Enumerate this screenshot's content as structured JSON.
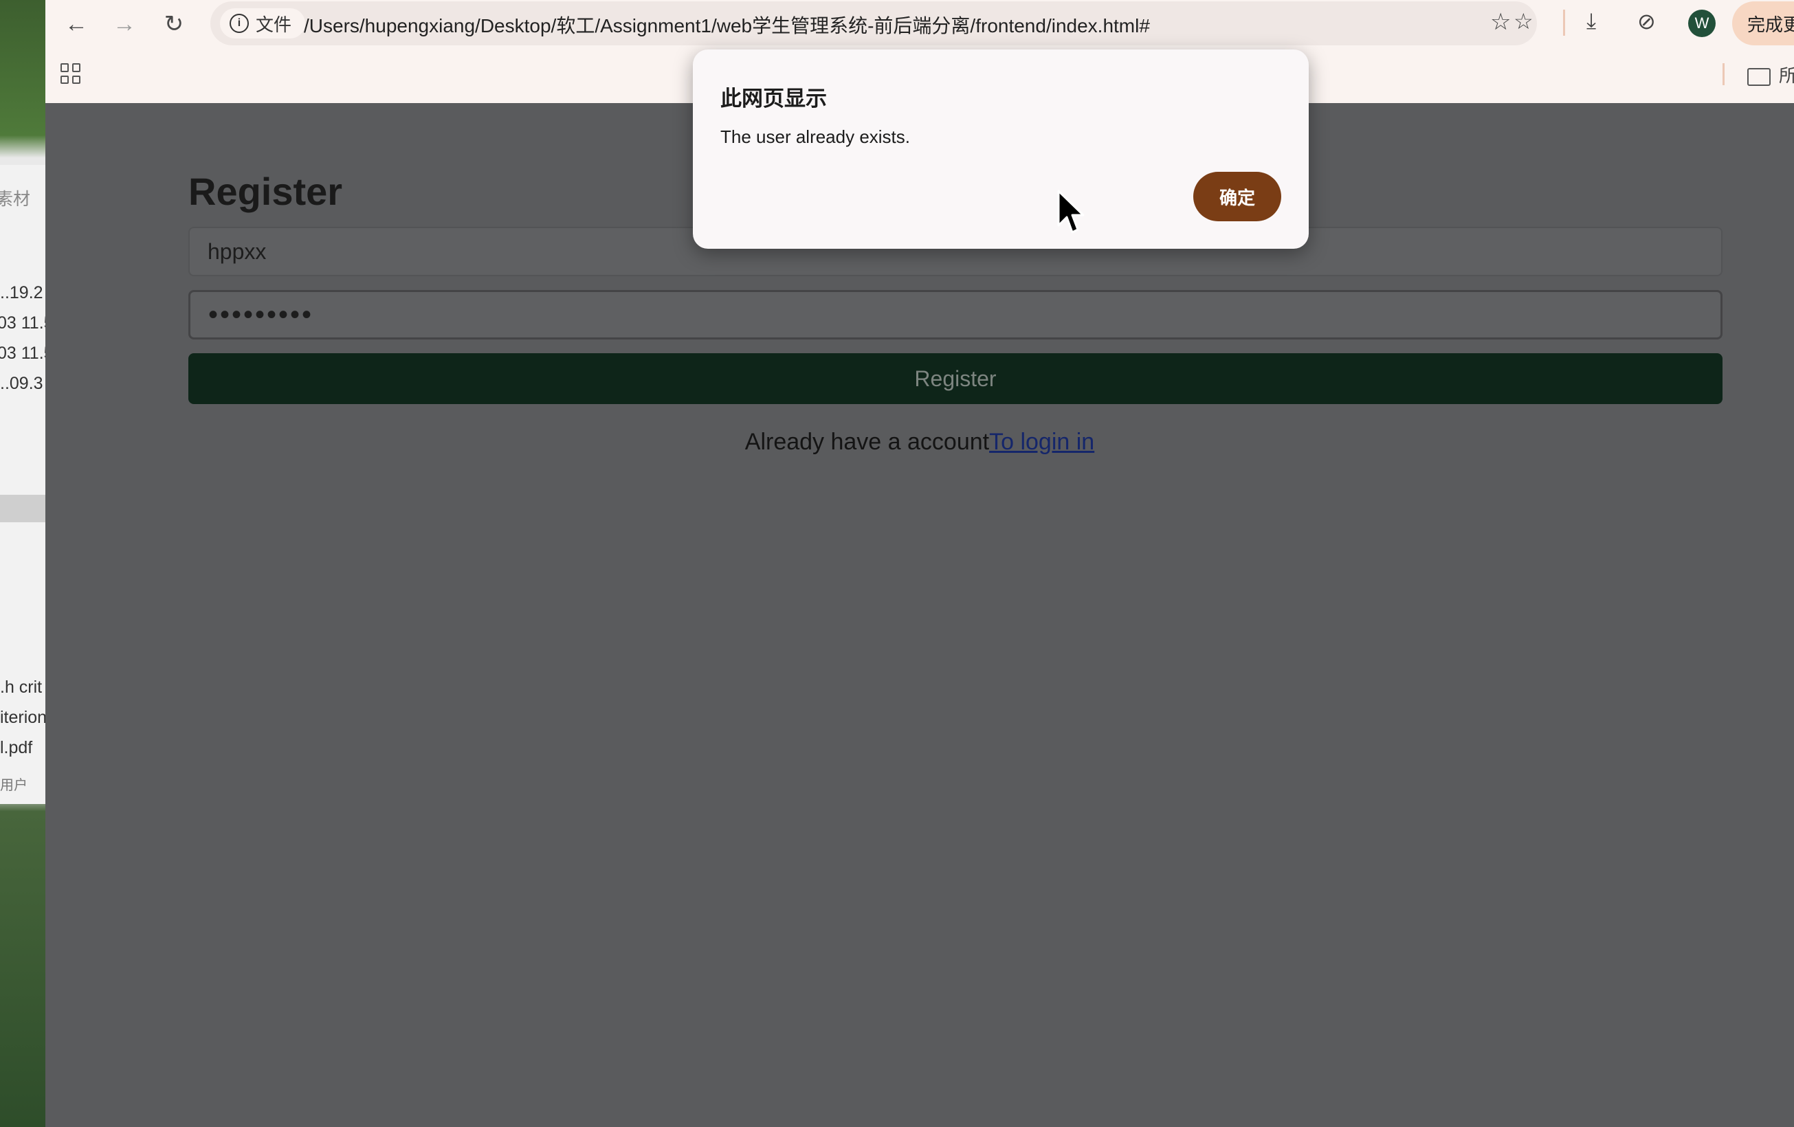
{
  "browser": {
    "address": {
      "badge_label": "文件",
      "url": "/Users/hupengxiang/Desktop/软工/Assignment1/web学生管理系统-前后端分离/frontend/index.html#"
    },
    "profile_initial": "W",
    "update_button_label": "完成更",
    "bookmarks_folder_label": "所"
  },
  "side_panel": {
    "label": "素材",
    "rows": [
      "..19.2",
      "03 11.5",
      "03 11.5",
      "..09.3",
      ".h crit",
      "iterion",
      "l.pdf",
      "用户"
    ]
  },
  "page": {
    "title": "Register",
    "username_value": "hppxx",
    "password_mask": "•••••••••",
    "register_button_label": "Register",
    "login_prompt": "Already have a account",
    "login_link": "To login in"
  },
  "dialog": {
    "title": "此网页显示",
    "message": "The user already exists.",
    "ok_label": "确定"
  },
  "colors": {
    "dialog_button": "#7a3d15",
    "register_button": "#0e2519",
    "overlay_background": "#5a5b5d"
  },
  "icons": [
    "back-arrow-icon",
    "forward-arrow-icon",
    "reload-icon",
    "info-icon",
    "bookmark-star-icon",
    "favorites-icon",
    "download-icon",
    "performance-icon",
    "apps-grid-icon",
    "folder-icon",
    "mouse-cursor-icon"
  ]
}
